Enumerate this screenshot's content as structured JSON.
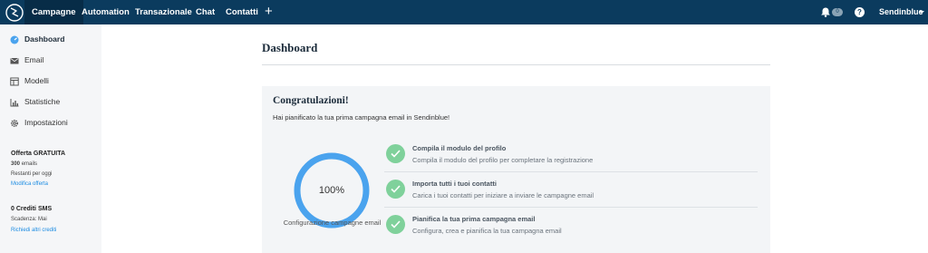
{
  "topbar": {
    "nav": [
      "Campagne",
      "Automation",
      "Transazionale",
      "Chat",
      "Contatti"
    ],
    "plus": "+",
    "notification_count": "0",
    "help": "?",
    "account": "Sendinblue"
  },
  "sidebar": {
    "items": [
      {
        "label": "Dashboard",
        "icon": "dashboard-icon"
      },
      {
        "label": "Email",
        "icon": "email-icon"
      },
      {
        "label": "Modelli",
        "icon": "templates-icon"
      },
      {
        "label": "Statistiche",
        "icon": "stats-icon"
      },
      {
        "label": "Impostazioni",
        "icon": "gear-icon"
      }
    ],
    "plan": {
      "title": "Offerta GRATUITA",
      "emails_count": "300",
      "emails_unit": "emails",
      "remaining": "Restanti per oggi",
      "modify_link": "Modifica offerta"
    },
    "sms": {
      "title": "0 Crediti SMS",
      "expiry": "Scadenza: Mai",
      "request_link": "Richiedi altri crediti"
    }
  },
  "main": {
    "title": "Dashboard",
    "card": {
      "title": "Congratulazioni!",
      "subtitle": "Hai pianificato la tua prima campagna email in Sendinblue!",
      "progress_value": "100%",
      "progress_fraction": 1.0,
      "progress_label": "Configurazione campagne email",
      "tasks": [
        {
          "title": "Compila il modulo del profilo",
          "desc": "Compila il modulo del profilo per completare la registrazione"
        },
        {
          "title": "Importa tutti i tuoi contatti",
          "desc": "Carica i tuoi contatti per iniziare a inviare le campagne email"
        },
        {
          "title": "Pianifica la tua prima campagna email",
          "desc": "Configura, crea e pianifica la tua campagna email"
        }
      ]
    }
  },
  "colors": {
    "topbar": "#0b3b5e",
    "accent": "#4aa3ee",
    "success": "#7fd19b",
    "link": "#1a8be2"
  }
}
